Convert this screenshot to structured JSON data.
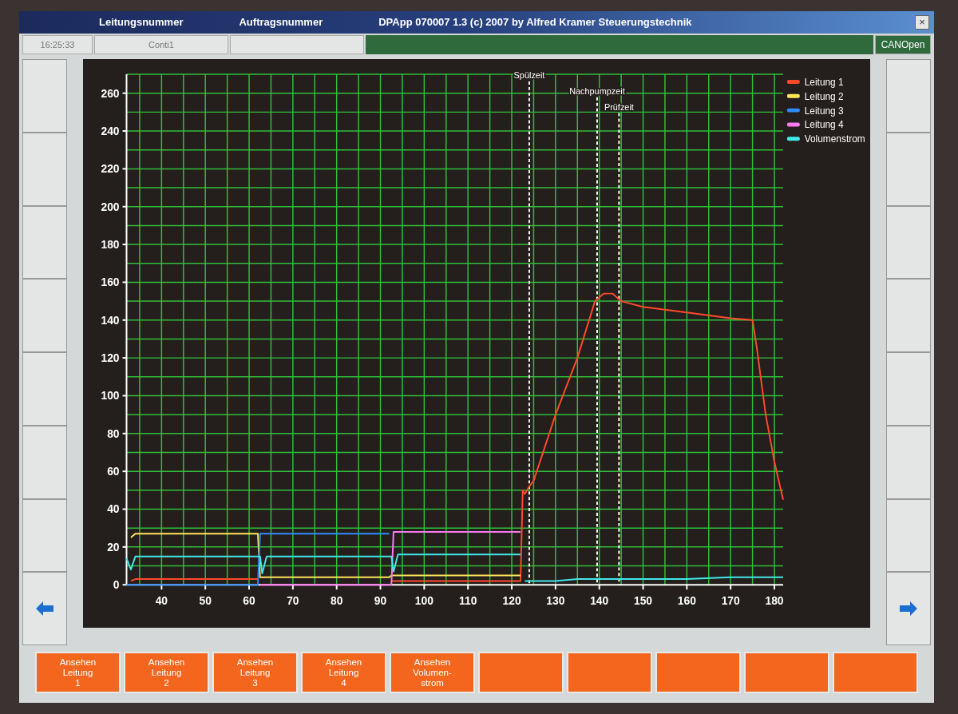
{
  "title_bar": {
    "fields": [
      "Leitungsnummer",
      "Auftragsnummer"
    ],
    "title": "DPApp 070007 1.3 (c) 2007 by Alfred Kramer Steuerungstechnik",
    "close": "×"
  },
  "status_row": {
    "time": "16:25:33",
    "name": "Conti1",
    "bus": "CANOpen"
  },
  "left_buttons": [
    {
      "kind": "blank"
    },
    {
      "kind": "blank"
    },
    {
      "kind": "blank"
    },
    {
      "kind": "blank"
    },
    {
      "kind": "blank"
    },
    {
      "kind": "blank"
    },
    {
      "kind": "blank"
    },
    {
      "kind": "arrow_left"
    }
  ],
  "right_buttons": [
    {
      "kind": "blank"
    },
    {
      "kind": "blank"
    },
    {
      "kind": "blank"
    },
    {
      "kind": "blank"
    },
    {
      "kind": "blank"
    },
    {
      "kind": "blank"
    },
    {
      "kind": "blank"
    },
    {
      "kind": "arrow_right"
    }
  ],
  "chart_data": {
    "type": "line",
    "x": [
      32,
      33,
      34,
      36,
      40,
      50,
      60,
      62,
      62.5,
      63,
      64,
      66,
      70,
      80,
      90,
      92,
      92.5,
      93,
      94,
      96,
      100,
      110,
      120,
      122,
      122.5,
      123,
      124,
      125,
      130,
      135,
      139,
      141,
      143,
      145,
      150,
      160,
      170,
      175,
      176,
      178,
      180,
      182
    ],
    "series": [
      {
        "name": "Leitung 1",
        "color": "#ff4a2a",
        "values": [
          null,
          2,
          3,
          3,
          3,
          3,
          3,
          3,
          null,
          null,
          null,
          null,
          null,
          null,
          null,
          null,
          2,
          2,
          2,
          2,
          2,
          2,
          2,
          2,
          50,
          48,
          52,
          55,
          90,
          120,
          150,
          154,
          154,
          150,
          147,
          144,
          141,
          140,
          125,
          90,
          65,
          45
        ]
      },
      {
        "name": "Leitung 2",
        "color": "#ffe65a",
        "values": [
          null,
          25,
          27,
          27,
          27,
          27,
          27,
          27,
          4,
          4,
          4,
          4,
          4,
          4,
          4,
          4,
          5,
          5,
          5,
          5,
          5,
          5,
          5,
          5,
          null,
          null,
          null,
          null,
          null,
          null,
          null,
          null,
          null,
          null,
          null,
          null,
          null,
          null,
          null,
          null,
          null,
          null
        ]
      },
      {
        "name": "Leitung 3",
        "color": "#2f8cff",
        "values": [
          0,
          0,
          0,
          0,
          0,
          0,
          0,
          0,
          27,
          27,
          27,
          27,
          27,
          27,
          27,
          27,
          null,
          null,
          null,
          null,
          null,
          null,
          null,
          null,
          null,
          null,
          null,
          null,
          null,
          null,
          null,
          null,
          null,
          null,
          null,
          null,
          null,
          null,
          null,
          null,
          null,
          null
        ]
      },
      {
        "name": "Leitung 4",
        "color": "#ff7aee",
        "values": [
          null,
          null,
          null,
          null,
          null,
          null,
          null,
          null,
          0,
          0,
          0,
          0,
          0,
          0,
          0,
          0,
          0,
          28,
          28,
          28,
          28,
          28,
          28,
          28,
          null,
          null,
          null,
          null,
          null,
          null,
          null,
          null,
          null,
          null,
          null,
          null,
          null,
          null,
          null,
          null,
          null,
          null
        ]
      },
      {
        "name": "Volumenstrom",
        "color": "#40e8e8",
        "values": [
          14,
          8,
          15,
          15,
          15,
          15,
          15,
          15,
          15,
          6,
          15,
          15,
          15,
          15,
          15,
          15,
          15,
          7,
          16,
          16,
          16,
          16,
          16,
          16,
          null,
          2,
          2,
          2,
          2,
          3,
          3,
          3,
          3,
          3,
          3,
          3,
          4,
          4,
          4,
          4,
          4,
          4
        ]
      }
    ],
    "xlim": [
      32,
      182
    ],
    "ylim": [
      0,
      270
    ],
    "xticks": [
      40,
      50,
      60,
      70,
      80,
      90,
      100,
      110,
      120,
      130,
      140,
      150,
      160,
      170,
      180
    ],
    "yticks": [
      0,
      20,
      40,
      60,
      80,
      100,
      120,
      140,
      160,
      180,
      200,
      220,
      240,
      260
    ],
    "grid": true,
    "legend": true,
    "ref_lines": [
      {
        "axis": "x",
        "value": 124,
        "label": "Spülzeit"
      },
      {
        "axis": "x",
        "value": 139.5,
        "label": "Nachpumpzeit"
      },
      {
        "axis": "x",
        "value": 144.5,
        "label": "Prüfzeit"
      }
    ]
  },
  "bottom_buttons": [
    {
      "kind": "labeled",
      "label": "Ansehen\nLeitung\n1"
    },
    {
      "kind": "labeled",
      "label": "Ansehen\nLeitung\n2"
    },
    {
      "kind": "labeled",
      "label": "Ansehen\nLeitung\n3"
    },
    {
      "kind": "labeled",
      "label": "Ansehen\nLeitung\n4"
    },
    {
      "kind": "labeled",
      "label": "Ansehen\nVolumen-\nstrom"
    },
    {
      "kind": "blank"
    },
    {
      "kind": "blank"
    },
    {
      "kind": "blank"
    },
    {
      "kind": "blank"
    },
    {
      "kind": "blank"
    }
  ]
}
